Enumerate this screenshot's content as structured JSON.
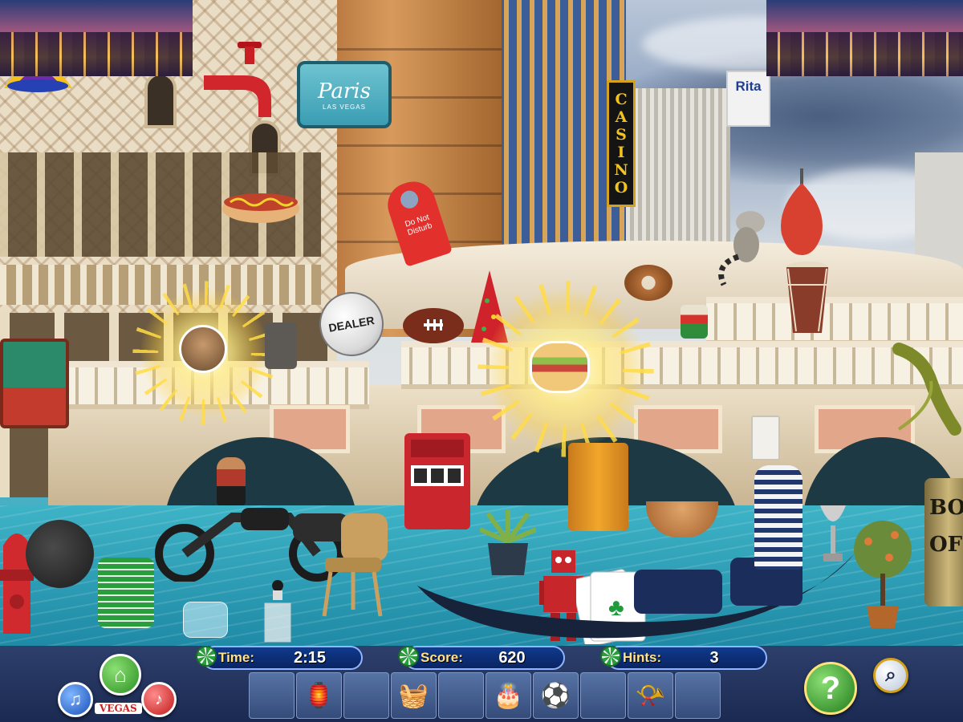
{
  "scene": {
    "signs": {
      "casino": "CASINO",
      "paris_script": "Paris",
      "paris_small": "LAS VEGAS",
      "rita": "Rita",
      "dealer": "DEALER",
      "do_not_disturb": "Do Not Disturb",
      "box_office": "BOX OFFICE"
    },
    "hidden_objects": [
      "faucet-icon",
      "hotdog-icon",
      "showgirl-headdress-icon",
      "dealer-button-icon",
      "do-not-disturb-sign-icon",
      "football-icon",
      "party-hat-icon",
      "donut-icon",
      "drum-icon",
      "punching-bag-icon",
      "lemur-icon",
      "iguana-icon",
      "slot-machine-icon",
      "motorcycle-icon",
      "poker-chips-icon",
      "fire-hydrant-icon",
      "chair-icon",
      "robot-icon",
      "playing-cards-icon",
      "trophy-icon",
      "potted-plant-icon",
      "bread-basket-icon",
      "outlet-icon",
      "perfume-bottle-icon",
      "barrel-icon",
      "gondola-icon",
      "money-case-icon"
    ]
  },
  "hud": {
    "time_label": "Time:",
    "time_value": "2:15",
    "score_label": "Score:",
    "score_value": "620",
    "hints_label": "Hints:",
    "hints_value": "3",
    "vegas_label": "VEGAS",
    "find_slots": [
      {
        "icon": "empty-slot",
        "glyph": ""
      },
      {
        "icon": "lamp-icon",
        "glyph": "🏮"
      },
      {
        "icon": "empty-slot",
        "glyph": ""
      },
      {
        "icon": "basket-icon",
        "glyph": "🧺"
      },
      {
        "icon": "empty-slot",
        "glyph": ""
      },
      {
        "icon": "stacking-rings-icon",
        "glyph": "🎂"
      },
      {
        "icon": "soccer-ball-icon",
        "glyph": "⚽"
      },
      {
        "icon": "empty-slot",
        "glyph": ""
      },
      {
        "icon": "whistle-icon",
        "glyph": "📯"
      },
      {
        "icon": "empty-slot",
        "glyph": ""
      }
    ],
    "buttons": {
      "home": "⌂",
      "music": "♫",
      "sound": "♪",
      "help": "?",
      "zoom": "⌕"
    }
  },
  "colors": {
    "hud_bar": "#0f3a8c",
    "label_yellow": "#ffe28a",
    "help_green": "#2b8f22",
    "sign_gold": "#f2c21e"
  }
}
